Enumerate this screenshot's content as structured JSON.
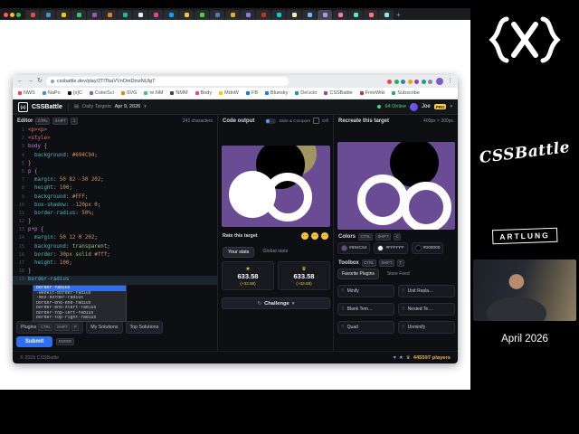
{
  "browser": {
    "traffic_lights": [
      "#ff5f57",
      "#febc2e",
      "#28c840"
    ],
    "active_tab": 19,
    "tabs": [
      "#e74c3c",
      "#3498db",
      "#f1c40f",
      "#2ecc71",
      "#9b59b6",
      "#e67e22",
      "#1abc9c",
      "#ecf0f1",
      "#e84393",
      "#00a8ff",
      "#fbc531",
      "#4cd137",
      "#487eb0",
      "#e1b12c",
      "#8c7ae6",
      "#c23616",
      "#00cec9",
      "#ffeaa7",
      "#74b9ff",
      "#a29bfe",
      "#fd79a8",
      "#55efc4",
      "#ff7675",
      "#81ecec"
    ],
    "url": "cssbattle.dev/play/2TlTbaVVnOmDmzNUlg7",
    "extensions": [
      "#e74c3c",
      "#27ae60",
      "#2980b9",
      "#f39c12",
      "#8e44ad",
      "#16a085",
      "#7f8c8d"
    ],
    "bookmarks": [
      {
        "c": "#e74c3c",
        "label": "NWS"
      },
      {
        "c": "#3498db",
        "label": "NaPo"
      },
      {
        "c": "#111111",
        "label": "{x}C"
      },
      {
        "c": "#9b59b6",
        "label": "ColorSci"
      },
      {
        "c": "#e67e22",
        "label": "SVG"
      },
      {
        "c": "#2ecc71",
        "label": "re.NM"
      },
      {
        "c": "#34495e",
        "label": "NMM"
      },
      {
        "c": "#e84393",
        "label": "Body"
      },
      {
        "c": "#f1c40f",
        "label": "MdnW"
      },
      {
        "c": "#1877f2",
        "label": "FB"
      },
      {
        "c": "#0a7cff",
        "label": "Bluesky"
      },
      {
        "c": "#16a085",
        "label": "Del.icio"
      },
      {
        "c": "#8e44ad",
        "label": "CSSBattle"
      },
      {
        "c": "#c0392b",
        "label": "FreeWiki"
      },
      {
        "c": "#27ae60",
        "label": "Subscribe"
      }
    ]
  },
  "nav": {
    "logo": "{x}",
    "brand": "CSSBattle",
    "calendar_icon": "▤",
    "daily_targets": "Daily Targets",
    "date": "Apr 9, 2026",
    "online": "64 Online",
    "user": "Joe",
    "badge": "PRO"
  },
  "editor": {
    "title": "Editor",
    "kbd": [
      "CTRL",
      "SHIFT",
      "1"
    ],
    "char_count": "241 characters",
    "active_line": 18,
    "code": [
      [
        [
          "t",
          "<p><p>"
        ]
      ],
      [
        [
          "t",
          "<style>"
        ]
      ],
      [
        [
          "s",
          "body "
        ],
        [
          "x",
          "{"
        ]
      ],
      [
        [
          "x",
          "  "
        ],
        [
          "p",
          "background"
        ],
        [
          "x",
          ": "
        ],
        [
          "h",
          "#694C94"
        ],
        [
          "x",
          ";"
        ]
      ],
      [
        [
          "x",
          "}"
        ]
      ],
      [
        [
          "s",
          "p "
        ],
        [
          "x",
          "{"
        ]
      ],
      [
        [
          "x",
          "  "
        ],
        [
          "p",
          "margin"
        ],
        [
          "x",
          ": "
        ],
        [
          "n",
          "50 82 -30 202"
        ],
        [
          "x",
          ";"
        ]
      ],
      [
        [
          "x",
          "  "
        ],
        [
          "p",
          "height"
        ],
        [
          "x",
          ": "
        ],
        [
          "n",
          "100"
        ],
        [
          "x",
          ";"
        ]
      ],
      [
        [
          "x",
          "  "
        ],
        [
          "p",
          "background"
        ],
        [
          "x",
          ": "
        ],
        [
          "h",
          "#FFF"
        ],
        [
          "x",
          ";"
        ]
      ],
      [
        [
          "x",
          "  "
        ],
        [
          "p",
          "box-shadow"
        ],
        [
          "x",
          ": "
        ],
        [
          "n",
          "-120px 0"
        ],
        [
          "x",
          ";"
        ]
      ],
      [
        [
          "x",
          "  "
        ],
        [
          "p",
          "border-radius"
        ],
        [
          "x",
          ": "
        ],
        [
          "n",
          "50%"
        ],
        [
          "x",
          ";"
        ]
      ],
      [
        [
          "x",
          "}"
        ]
      ],
      [
        [
          "s",
          "p+p "
        ],
        [
          "x",
          "{"
        ]
      ],
      [
        [
          "x",
          "  "
        ],
        [
          "p",
          "margin"
        ],
        [
          "x",
          ": "
        ],
        [
          "n",
          "50 12 0 202"
        ],
        [
          "x",
          ";"
        ]
      ],
      [
        [
          "x",
          "  "
        ],
        [
          "p",
          "background"
        ],
        [
          "x",
          ": "
        ],
        [
          "v",
          "transparent"
        ],
        [
          "x",
          ";"
        ]
      ],
      [
        [
          "x",
          "  "
        ],
        [
          "p",
          "border"
        ],
        [
          "x",
          ": "
        ],
        [
          "n",
          "30px"
        ],
        [
          "v",
          " solid "
        ],
        [
          "h",
          "#fff"
        ],
        [
          "x",
          ";"
        ]
      ],
      [
        [
          "x",
          "  "
        ],
        [
          "p",
          "height"
        ],
        [
          "x",
          ": "
        ],
        [
          "n",
          "100"
        ],
        [
          "x",
          ";"
        ]
      ],
      [
        [
          "x",
          "}"
        ]
      ],
      [
        [
          "p",
          "border-radius"
        ]
      ]
    ],
    "autocomplete": [
      "border-radius",
      "-webkit-border-radius",
      "-moz-border-radius",
      "border-end-end-radius",
      "border-end-start-radius",
      "border-top-left-radius",
      "border-top-right-radius"
    ],
    "tabs": [
      {
        "label": "Plugins",
        "kbd": "CTRL SHIFT P"
      },
      {
        "label": "My Solutions"
      },
      {
        "label": "Top Solutions"
      }
    ],
    "submit": "Submit",
    "submit_kbd": "ENTER"
  },
  "output": {
    "title": "Code output",
    "slide_compare": "Slide & Compare",
    "diff": "Diff",
    "rate_label": "Rate this target",
    "emojis": [
      "angry-face",
      "neutral-face",
      "heart-eyes-face"
    ],
    "stats_tabs": [
      "Your stats",
      "Global stats"
    ],
    "scores": [
      {
        "icon": "★",
        "value": "633.58",
        "delta": "(+33.58)"
      },
      {
        "icon": "♛",
        "value": "633.58",
        "delta": "(+33.58)"
      }
    ],
    "challenge": "Challenge",
    "challenge_icon": "↻",
    "chevron": "▾"
  },
  "target": {
    "title": "Recreate this target",
    "size": "400px × 300px",
    "colors_label": "Colors",
    "colors_kbd": [
      "CTRL",
      "SHIFT",
      "C"
    ],
    "colors": [
      "#694C94",
      "#FFFFFF",
      "#000000"
    ],
    "toolbox_label": "Toolbox",
    "toolbox_kbd": [
      "CTRL",
      "SHIFT",
      "T"
    ],
    "toolbox_tabs": [
      "Favorite Plugins",
      "Store Feed"
    ],
    "plugins": [
      "Minify",
      "Unit Repla…",
      "Blank Tem…",
      "Nested Te…",
      "Quad",
      "Unminify"
    ]
  },
  "footer": {
    "copyright": "© 2025 CSSBattle",
    "icons": [
      "♥",
      "★",
      "♛"
    ],
    "players": "445597 players"
  },
  "overlay": {
    "brand_text": "CSSBattle",
    "artlung": "ARTLUNG",
    "date": "April 2026"
  }
}
